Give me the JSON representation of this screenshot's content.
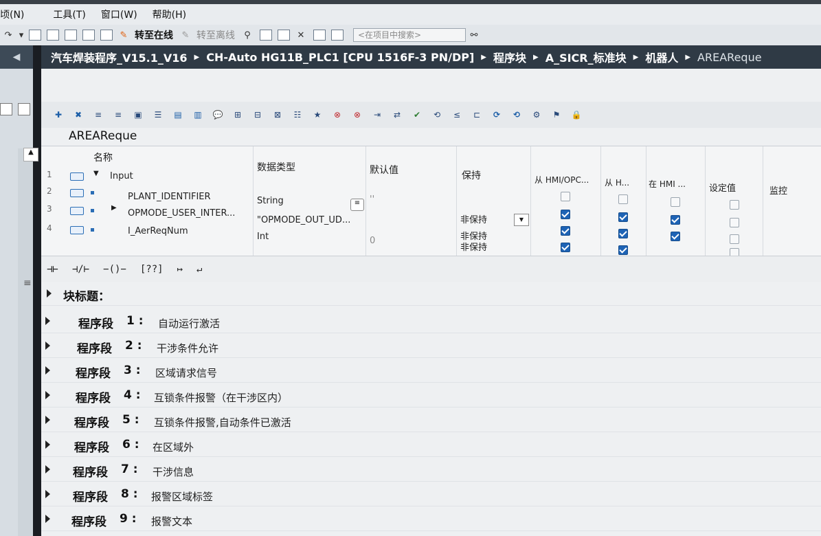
{
  "menu": [
    "顷(N)",
    "工具(T)",
    "窗口(W)",
    "帮助(H)"
  ],
  "toolbar": {
    "go_online": "转至在线",
    "go_offline": "转至离线",
    "search_placeholder": "<在项目中搜索>"
  },
  "breadcrumb": [
    "汽车焊装程序_V15.1_V16",
    "CH-Auto HG11B_PLC1 [CPU 1516F-3 PN/DP]",
    "程序块",
    "A_SICR_标准块",
    "机器人",
    "AREAReque"
  ],
  "block": {
    "title": "AREAReque"
  },
  "interface": {
    "headers": {
      "name": "名称",
      "datatype": "数据类型",
      "default": "默认值",
      "retain": "保持",
      "hmi_opc": "从 HMI/OPC...",
      "from_h": "从 H...",
      "in_hmi": "在 HMI ...",
      "setpoint": "设定值",
      "monitor": "监控"
    },
    "rows": [
      {
        "num": "1",
        "name": "Input",
        "type": "",
        "default": "",
        "retain": ""
      },
      {
        "num": "2",
        "name": "PLANT_IDENTIFIER",
        "type": "String",
        "default": "''",
        "retain": ""
      },
      {
        "num": "3",
        "name": "OPMODE_USER_INTER...",
        "type": "\"OPMODE_OUT_UD...",
        "default": "",
        "retain": "非保持"
      },
      {
        "num": "4",
        "name": "I_AerReqNum",
        "type": "Int",
        "default": "0",
        "retain": "非保持"
      }
    ],
    "retain_extra": "非保持"
  },
  "lad": [
    "⊣⊢",
    "⊣/⊢",
    "−()−",
    "[??]",
    "↦",
    "↵"
  ],
  "networks": {
    "block_title_label": "块标题：",
    "segment_label": "程序段",
    "items": [
      {
        "num": "1 :",
        "title": "自动运行激活"
      },
      {
        "num": "2 :",
        "title": "干涉条件允许"
      },
      {
        "num": "3 :",
        "title": "区域请求信号"
      },
      {
        "num": "4 :",
        "title": "互锁条件报警（在干涉区内）"
      },
      {
        "num": "5 :",
        "title": "互锁条件报警,自动条件已激活"
      },
      {
        "num": "6 :",
        "title": "在区域外"
      },
      {
        "num": "7 :",
        "title": "干涉信息"
      },
      {
        "num": "8 :",
        "title": "报警区域标签"
      },
      {
        "num": "9 :",
        "title": "报警文本"
      }
    ]
  },
  "colors": {
    "breadcrumb_bg": "#2f3a45",
    "checkbox_on": "#1e63b5"
  }
}
